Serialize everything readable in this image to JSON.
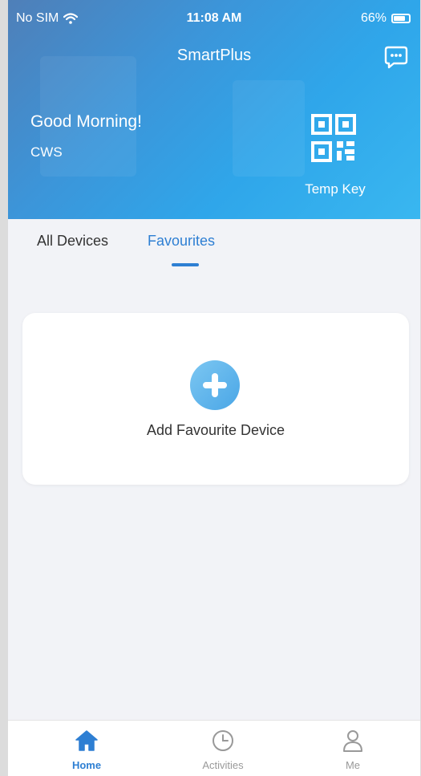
{
  "status_bar": {
    "carrier": "No SIM",
    "time": "11:08 AM",
    "battery": "66%"
  },
  "header": {
    "app_title": "SmartPlus",
    "greeting": "Good Morning!",
    "user_name": "CWS",
    "temp_key_label": "Temp Key"
  },
  "tabs": [
    {
      "label": "All Devices",
      "active": false
    },
    {
      "label": "Favourites",
      "active": true
    }
  ],
  "favourites_card": {
    "add_label": "Add Favourite Device"
  },
  "bottom_nav": [
    {
      "label": "Home",
      "icon": "home-icon",
      "active": true
    },
    {
      "label": "Activities",
      "icon": "clock-icon",
      "active": false
    },
    {
      "label": "Me",
      "icon": "person-icon",
      "active": false
    }
  ],
  "colors": {
    "accent": "#2e7fd3",
    "header_start": "#4f7fb8",
    "header_end": "#39b7f0",
    "background": "#f2f3f7"
  }
}
